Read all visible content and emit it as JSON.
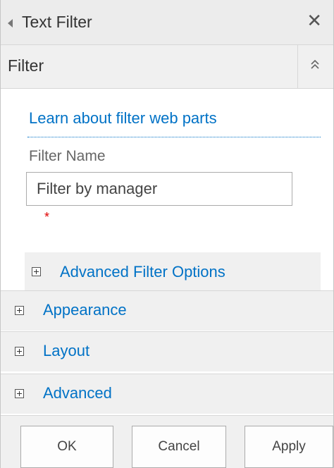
{
  "window": {
    "title": "Text Filter",
    "close_label": "✕"
  },
  "section": {
    "title": "Filter"
  },
  "filter": {
    "learn_link": "Learn about filter web parts",
    "name_label": "Filter Name",
    "name_value": "Filter by manager",
    "required_marker": "*",
    "advanced_options_label": "Advanced Filter Options"
  },
  "categories": [
    {
      "label": "Appearance"
    },
    {
      "label": "Layout"
    },
    {
      "label": "Advanced"
    }
  ],
  "buttons": {
    "ok": "OK",
    "cancel": "Cancel",
    "apply": "Apply"
  },
  "colors": {
    "link": "#0072c6",
    "required": "#e00000",
    "panel_bg": "#f0f0f0"
  }
}
